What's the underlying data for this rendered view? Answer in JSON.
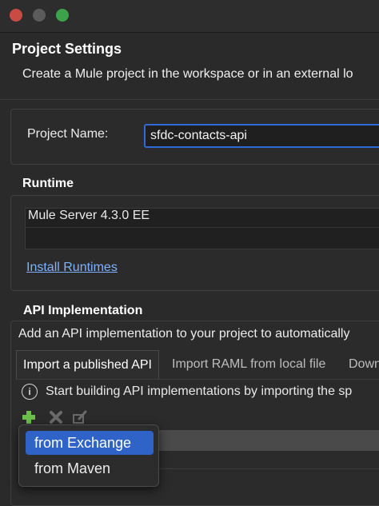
{
  "header": {
    "title": "Project Settings",
    "description": "Create a Mule project in the workspace or in an external lo"
  },
  "project": {
    "label": "Project Name:",
    "value": "sfdc-contacts-api"
  },
  "runtime": {
    "title": "Runtime",
    "items": [
      "Mule Server 4.3.0 EE"
    ],
    "install_link": "Install Runtimes"
  },
  "api": {
    "title": "API Implementation",
    "description": "Add an API implementation to your project to automatically",
    "tabs": [
      "Import a published API",
      "Import RAML from local file",
      "Down"
    ],
    "info_text": "Start building API implementations by importing the sp"
  },
  "dropdown": {
    "items": [
      "from Exchange",
      "from Maven"
    ]
  },
  "colors": {
    "accent": "#2f63c8",
    "link": "#7fb2ff",
    "close": "#c94b43",
    "zoom": "#3ea24a",
    "add_icon": "#6cc04a"
  }
}
